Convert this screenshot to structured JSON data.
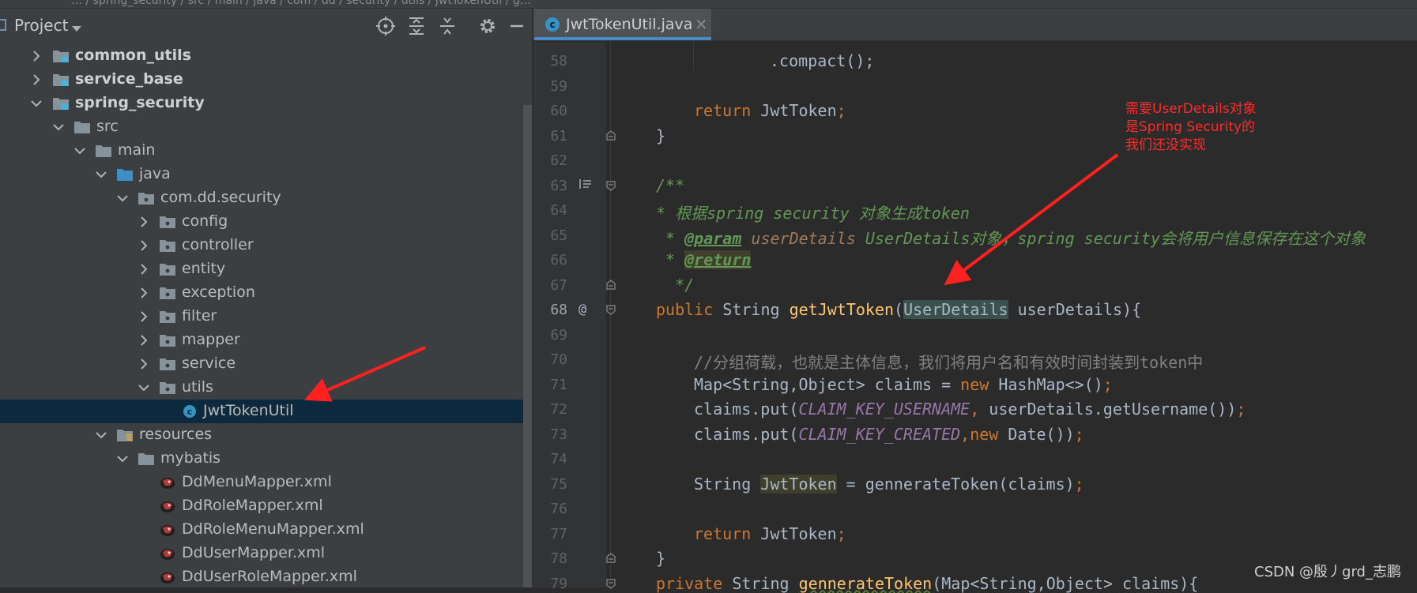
{
  "topbar": {
    "breadcrumb": "…  / spring_security / src / main / java / com / dd / security / utils / JwtTokenUtil / g…"
  },
  "project_panel": {
    "title": "Project",
    "tree": [
      {
        "label": "common_utils",
        "kind": "module",
        "bold": true,
        "expanded": false
      },
      {
        "label": "service_base",
        "kind": "module",
        "bold": true,
        "expanded": false
      },
      {
        "label": "spring_security",
        "kind": "module",
        "bold": true,
        "expanded": true
      },
      {
        "label": "src",
        "kind": "folder",
        "expanded": true
      },
      {
        "label": "main",
        "kind": "folder",
        "expanded": true
      },
      {
        "label": "java",
        "kind": "source-folder",
        "expanded": true
      },
      {
        "label": "com.dd.security",
        "kind": "package",
        "expanded": true
      },
      {
        "label": "config",
        "kind": "package",
        "expanded": false
      },
      {
        "label": "controller",
        "kind": "package",
        "expanded": false
      },
      {
        "label": "entity",
        "kind": "package",
        "expanded": false
      },
      {
        "label": "exception",
        "kind": "package",
        "expanded": false
      },
      {
        "label": "filter",
        "kind": "package",
        "expanded": false
      },
      {
        "label": "mapper",
        "kind": "package",
        "expanded": false
      },
      {
        "label": "service",
        "kind": "package",
        "expanded": false
      },
      {
        "label": "utils",
        "kind": "package",
        "expanded": true
      },
      {
        "label": "JwtTokenUtil",
        "kind": "class",
        "selected": true
      },
      {
        "label": "resources",
        "kind": "resources",
        "expanded": true
      },
      {
        "label": "mybatis",
        "kind": "folder",
        "expanded": true
      },
      {
        "label": "DdMenuMapper.xml",
        "kind": "xml"
      },
      {
        "label": "DdRoleMapper.xml",
        "kind": "xml"
      },
      {
        "label": "DdRoleMenuMapper.xml",
        "kind": "xml"
      },
      {
        "label": "DdUserMapper.xml",
        "kind": "xml"
      },
      {
        "label": "DdUserRoleMapper.xml",
        "kind": "xml"
      }
    ]
  },
  "editor": {
    "tab_label": "JwtTokenUtil.java",
    "tab_close": "×",
    "lines": [
      {
        "n": "58",
        "text": ".compact();"
      },
      {
        "n": "59",
        "text": ""
      },
      {
        "n": "60",
        "text": "return JwtToken;"
      },
      {
        "n": "61",
        "text": "}"
      },
      {
        "n": "62",
        "text": ""
      },
      {
        "n": "63",
        "text": "/**"
      },
      {
        "n": "64",
        "text": "* 根据spring security 对象生成token"
      },
      {
        "n": "65",
        "text": "* @param userDetails UserDetails对象，spring security会将用户信息保存在这个对象"
      },
      {
        "n": "66",
        "text": "* @return"
      },
      {
        "n": "67",
        "text": "*/"
      },
      {
        "n": "68",
        "text": "public String getJwtToken(UserDetails userDetails){"
      },
      {
        "n": "69",
        "text": ""
      },
      {
        "n": "70",
        "text": "//分组荷载，也就是主体信息，我们将用户名和有效时间封装到token中"
      },
      {
        "n": "71",
        "text": "Map<String,Object> claims = new HashMap<>();"
      },
      {
        "n": "72",
        "text": "claims.put(CLAIM_KEY_USERNAME, userDetails.getUsername());"
      },
      {
        "n": "73",
        "text": "claims.put(CLAIM_KEY_CREATED,new Date());"
      },
      {
        "n": "74",
        "text": ""
      },
      {
        "n": "75",
        "text": "String JwtToken = gennerateToken(claims);"
      },
      {
        "n": "76",
        "text": ""
      },
      {
        "n": "77",
        "text": "return JwtToken;"
      },
      {
        "n": "78",
        "text": "}"
      },
      {
        "n": "79",
        "text": "private String gennerateToken(Map<String,Object> claims){"
      }
    ],
    "current_line": "68",
    "gutter_marker_68": "@"
  },
  "annotation": {
    "lines": [
      "需要UserDetails对象",
      "是Spring Security的",
      "我们还没实现"
    ],
    "color": "#ff2a2a"
  },
  "watermark": "CSDN @殷丿grd_志鹏"
}
